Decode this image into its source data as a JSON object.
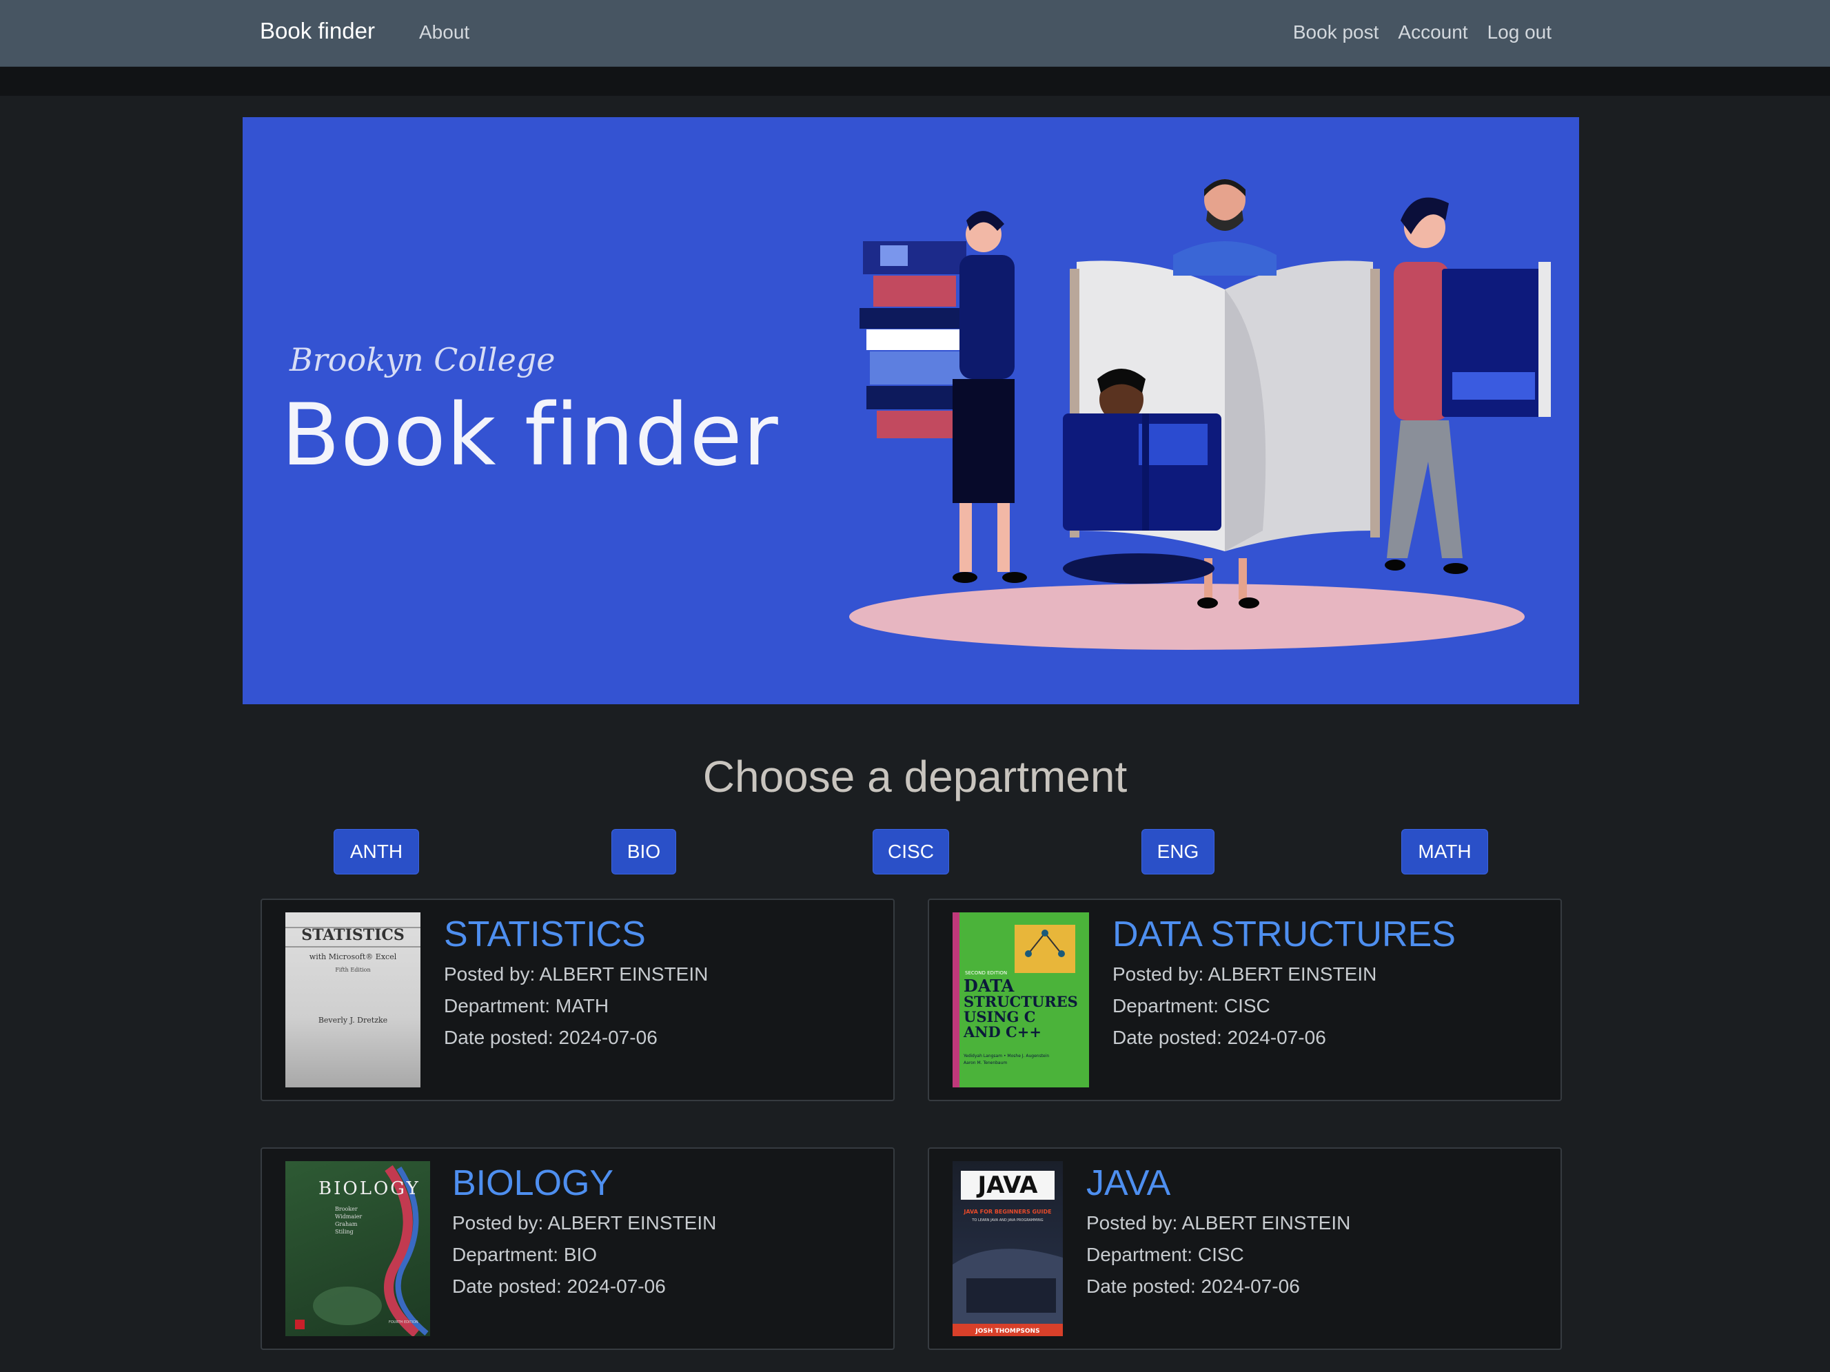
{
  "nav": {
    "brand": "Book finder",
    "about": "About",
    "book_post": "Book post",
    "account": "Account",
    "logout": "Log out"
  },
  "hero": {
    "subtitle": "Brookyn College",
    "title": "Book finder"
  },
  "departments": {
    "heading": "Choose a department",
    "buttons": [
      "ANTH",
      "BIO",
      "CISC",
      "ENG",
      "MATH"
    ]
  },
  "books": [
    {
      "title": "STATISTICS",
      "posted_by": "Posted by: ALBERT EINSTEIN",
      "department": "Department: MATH",
      "date": "Date posted: 2024-07-06",
      "cover": {
        "title": "STATISTICS",
        "subtitle": "with Microsoft® Excel",
        "edition": "Fifth Edition",
        "author": "Beverly J. Dretzke"
      }
    },
    {
      "title": "DATA STRUCTURES",
      "posted_by": "Posted by: ALBERT EINSTEIN",
      "department": "Department: CISC",
      "date": "Date posted: 2024-07-06",
      "cover": {
        "edition": "SECOND EDITION",
        "line1": "DATA",
        "line2": "STRUCTURES",
        "line3": "USING C",
        "line4": "AND C++",
        "authors": "Yedidyah Langsam • Moshe J. Augenstein",
        "authors2": "Aaron M. Tenenbaum"
      }
    },
    {
      "title": "BIOLOGY",
      "posted_by": "Posted by: ALBERT EINSTEIN",
      "department": "Department: BIO",
      "date": "Date posted: 2024-07-06",
      "cover": {
        "title": "BIOLOGY",
        "authors": [
          "Brooker",
          "Widmaier",
          "Graham",
          "Stiling"
        ],
        "edition": "FOURTH EDITION"
      }
    },
    {
      "title": "JAVA",
      "posted_by": "Posted by: ALBERT EINSTEIN",
      "department": "Department: CISC",
      "date": "Date posted: 2024-07-06",
      "cover": {
        "title": "JAVA",
        "subtitle": "JAVA FOR BEGINNERS GUIDE",
        "subtitle2": "TO LEARN JAVA AND JAVA PROGRAMMING",
        "author": "JOSH THOMPSONS"
      }
    }
  ],
  "colors": {
    "page_bg": "#1b1e21",
    "navbar_bg": "#475562",
    "hero_bg": "#3453d2",
    "button_bg": "#2a50c8",
    "title_link": "#4e8ff0",
    "card_bg": "#141618"
  }
}
